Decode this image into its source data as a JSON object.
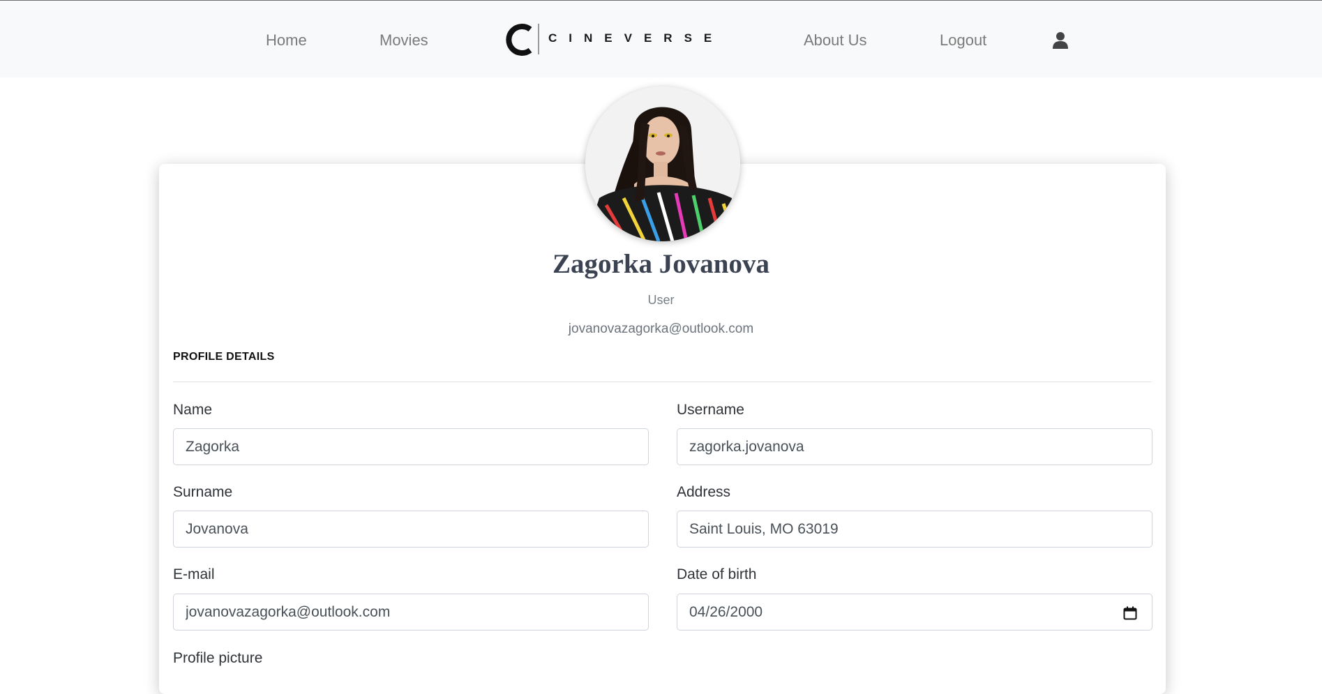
{
  "nav": {
    "home": "Home",
    "movies": "Movies",
    "brand": "CINEVERSE",
    "about": "About Us",
    "logout": "Logout",
    "user_icon": "user-icon"
  },
  "profile": {
    "name": "Zagorka Jovanova",
    "role": "User",
    "email": "jovanovazagorka@outlook.com"
  },
  "details": {
    "section_title": "PROFILE DETAILS",
    "name_label": "Name",
    "name_value": "Zagorka",
    "username_label": "Username",
    "username_value": "zagorka.jovanova",
    "surname_label": "Surname",
    "surname_value": "Jovanova",
    "address_label": "Address",
    "address_value": "Saint Louis, MO 63019",
    "email_label": "E-mail",
    "email_value": "jovanovazagorka@outlook.com",
    "dob_label": "Date of birth",
    "dob_value": "04/26/2000",
    "next_label": "Profile picture"
  },
  "colors": {
    "navbar_bg": "#f8f9fa",
    "name_color": "#3b4353",
    "input_border": "#ced4da"
  }
}
